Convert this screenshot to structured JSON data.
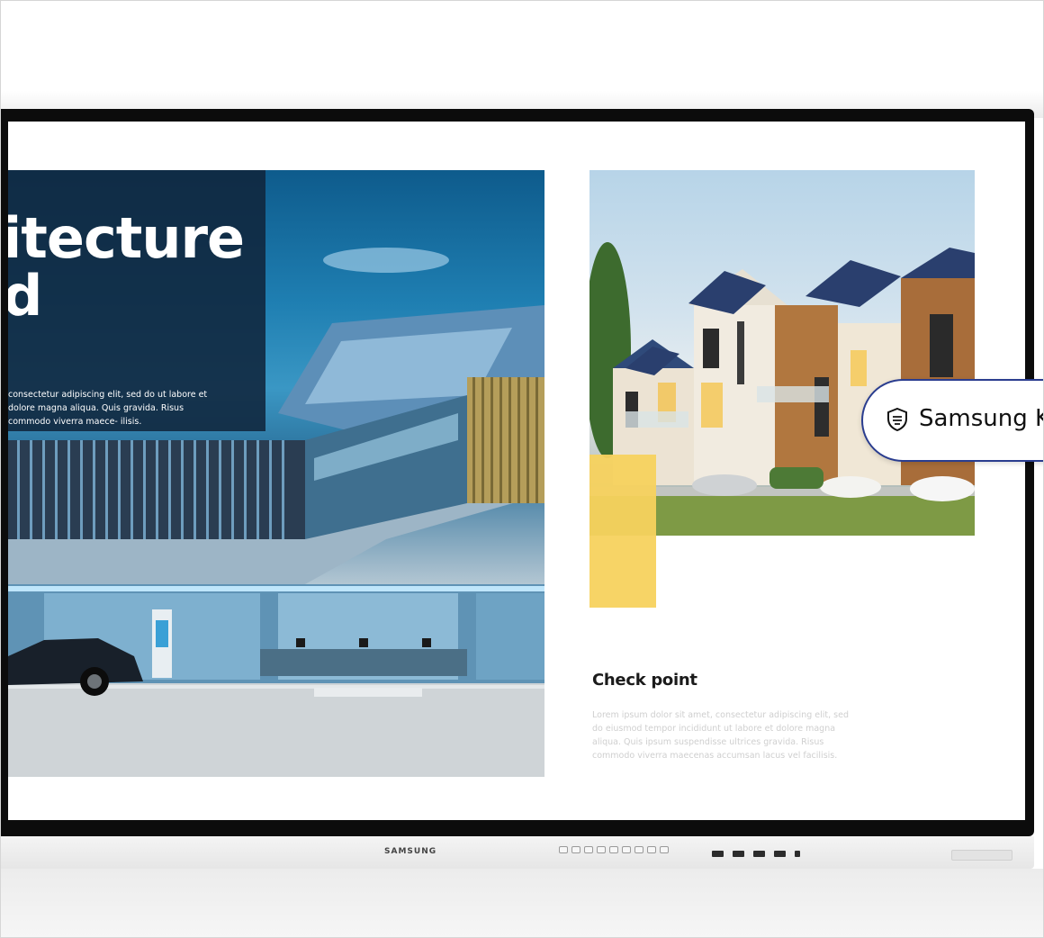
{
  "hero": {
    "title": "itecture\nd",
    "body": "consectetur adipiscing elit, sed do ut labore et dolore magna aliqua. Quis gravida. Risus commodo viverra maece- ilisis."
  },
  "panel": {
    "check_title": "Check point",
    "check_body": "Lorem ipsum dolor sit amet, consectetur adipiscing elit, sed do eiusmod tempor incididunt ut labore et dolore magna aliqua. Quis ipsum suspendisse ultrices gravida. Risus commodo viverra maecenas accumsan lacus vel facilisis."
  },
  "badge": {
    "label": "Samsung K",
    "icon": "knox-shield-icon"
  },
  "device": {
    "brand": "SAMSUNG"
  },
  "colors": {
    "accent_yellow": "#f7d25e",
    "knox_border": "#2a3d8f",
    "bezel": "#0c0c0c"
  }
}
